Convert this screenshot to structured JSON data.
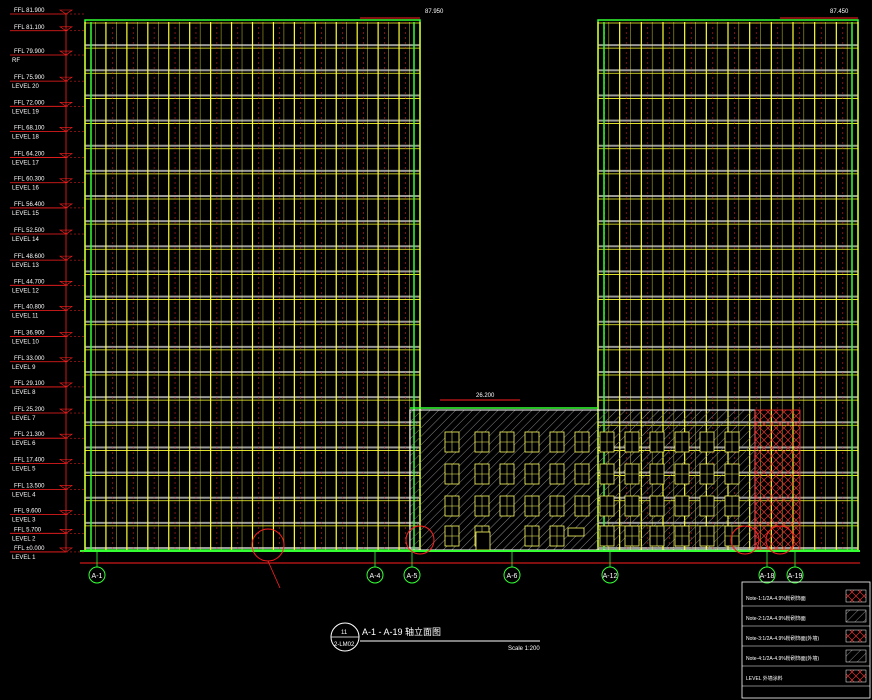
{
  "levels": [
    {
      "elev": "FFL 81.900",
      "name": ""
    },
    {
      "elev": "FFL 81.100",
      "name": ""
    },
    {
      "elev": "FFL 79.900",
      "name": "RF"
    },
    {
      "elev": "FFL 75.900",
      "name": "LEVEL 20"
    },
    {
      "elev": "FFL 72.000",
      "name": "LEVEL 19"
    },
    {
      "elev": "FFL 68.100",
      "name": "LEVEL 18"
    },
    {
      "elev": "FFL 64.200",
      "name": "LEVEL 17"
    },
    {
      "elev": "FFL 60.300",
      "name": "LEVEL 16"
    },
    {
      "elev": "FFL 56.400",
      "name": "LEVEL 15"
    },
    {
      "elev": "FFL 52.500",
      "name": "LEVEL 14"
    },
    {
      "elev": "FFL 48.600",
      "name": "LEVEL 13"
    },
    {
      "elev": "FFL 44.700",
      "name": "LEVEL 12"
    },
    {
      "elev": "FFL 40.800",
      "name": "LEVEL 11"
    },
    {
      "elev": "FFL 36.900",
      "name": "LEVEL 10"
    },
    {
      "elev": "FFL 33.000",
      "name": "LEVEL 9"
    },
    {
      "elev": "FFL 29.100",
      "name": "LEVEL 8"
    },
    {
      "elev": "FFL 25.200",
      "name": "LEVEL 7"
    },
    {
      "elev": "FFL 21.300",
      "name": "LEVEL 6"
    },
    {
      "elev": "FFL 17.400",
      "name": "LEVEL 5"
    },
    {
      "elev": "FFL 13.500",
      "name": "LEVEL 4"
    },
    {
      "elev": "FFL 9.600",
      "name": "LEVEL 3"
    },
    {
      "elev": "FFL 5.700",
      "name": "LEVEL 2"
    },
    {
      "elev": "FFL ±0.000",
      "name": "LEVEL 1"
    }
  ],
  "top_elevations": {
    "left": "87.950",
    "right": "87.450",
    "podium": "26.200"
  },
  "axes": [
    "A-1",
    "A-4",
    "A-5",
    "A-6",
    "A-12",
    "A-18",
    "A-19"
  ],
  "title": {
    "number": "11",
    "sheet": "2-LM02",
    "text": "A-1 - A-19 轴立面图",
    "scale": "Scale 1:200"
  },
  "legend": [
    "Note-1:1/2A-4.9%粉刷饰面",
    "Note-2:1/2A-4.9%粉刷饰面",
    "Note-3:1/2A-4.9%粉刷饰面(外墙)",
    "Note-4:1/2A-4.9%粉刷饰面(外墙)",
    "LEVEL 外墙涂料"
  ],
  "colors": {
    "background": "#000000",
    "facade_frame": "#ffff33",
    "wall": "#33ff33",
    "red": "#ff2020",
    "gray": "#9a9a9a",
    "white": "#ffffff"
  }
}
